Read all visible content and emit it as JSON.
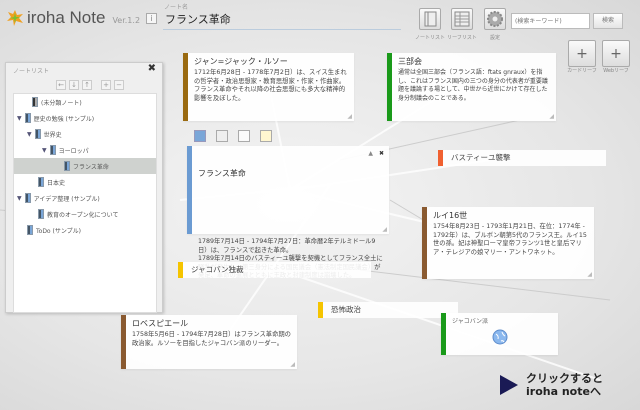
{
  "app": {
    "name": "iroha Note",
    "version": "Ver.1.2",
    "info_label": "i"
  },
  "note_name": {
    "label": "ノート名",
    "value": "フランス革命"
  },
  "toolbar": {
    "notelist": "ノートリスト",
    "leaflist": "リーフリスト",
    "settings": "設定"
  },
  "search": {
    "placeholder": "(検索キーワード)",
    "button": "検索"
  },
  "leaf_buttons": {
    "card": "カードリーフ",
    "web": "Webリーフ"
  },
  "panel": {
    "title": "ノートリスト",
    "close": "✖",
    "tools": [
      "←",
      "↓",
      "↑",
      "+",
      "−"
    ],
    "items": [
      {
        "label": "(未分類ノート)"
      },
      {
        "label": "歴史の勉強 (サンプル)"
      },
      {
        "label": "世界史"
      },
      {
        "label": "ヨーロッパ"
      },
      {
        "label": "フランス革命"
      },
      {
        "label": "日本史"
      },
      {
        "label": "アイデア整理 (サンプル)"
      },
      {
        "label": "教育のオープン化について"
      },
      {
        "label": "ToDo (サンプル)"
      }
    ]
  },
  "cards": {
    "rousseau": {
      "title": "ジャン=ジャック・ルソー",
      "body": "1712年6月28日 - 1778年7月2日）は、スイス生まれの哲学者・政治思想家・教育思想家・作家・作曲家。フランス革命やそれ以降の社会思想にも多大な精神的影響を及ぼした。",
      "color": "#9a6a10"
    },
    "estates": {
      "title": "三部会",
      "body": "通常は全国三部会（フランス語：ftats gnraux）を指し、これはフランス国内の三つの身分の代表者が重要議題を議論する場として、中世から近世にかけて存在した身分制議会のことである。",
      "color": "#1a9a1a"
    },
    "revolution": {
      "title": "フランス革命",
      "body": "1789年7月14日 - 1794年7月27日：革命暦2年テルミドール9日）は、フランスで起きた革命。\n1789年7月14日のバスティーユ襲撃を契機としてフランス全土に騒乱が発生し、第三身分による国民議会（憲法制定国民議会）が発足、革命の進展とともに王政と封建制度は崩壊した。",
      "color": "#6b9bd2"
    },
    "louis": {
      "title": "ルイ16世",
      "body": "1754年8月23日 - 1793年1月21日、在位：1774年 - 1792年）は、ブルボン朝第5代のフランス王。ルイ15世の孫。妃は神聖ローマ皇帝フランツ1世と皇后マリア・テレジアの娘マリー・アントワネット。",
      "color": "#8a5a30"
    },
    "robespierre": {
      "title": "ロベスピエール",
      "body": "1758年5月6日 - 1794年7月28日）はフランス革命期の政治家。ルソーを目指したジャコバン派のリーダー。",
      "color": "#8a5a30"
    },
    "jacobins": {
      "title": "ジャコバン派",
      "color": "#1a9a1a"
    }
  },
  "strips": {
    "bastille": {
      "title": "バスティーユ襲撃",
      "color": "#f06030"
    },
    "jacobin_dict": {
      "title": "ジャコバン独裁",
      "color": "#f5c400"
    },
    "terror": {
      "title": "恐怖政治",
      "color": "#f5c400"
    }
  },
  "cta": {
    "line1": "クリックすると",
    "line2": "iroha noteへ"
  }
}
